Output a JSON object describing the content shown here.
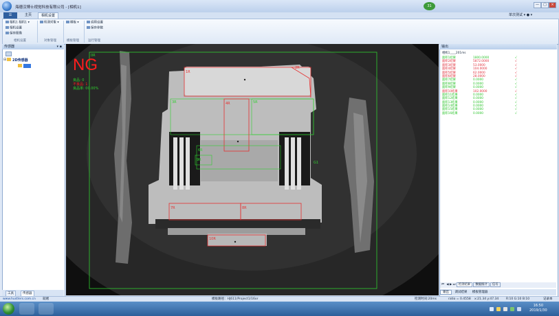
{
  "window": {
    "title": "海德汉博士视觉科技有限公司 - [相机1]",
    "status_badge": "31",
    "user_mode": "单次测试",
    "controls": [
      "—",
      "□",
      "×"
    ]
  },
  "ribbon_tabs": [
    "主页",
    "相机设置"
  ],
  "ribbon": {
    "camera_select": "相机1 相机1",
    "camera_settings": "相机设置",
    "save_image": "保存图像",
    "detect_object": "检测对象",
    "template": "模板",
    "run_settings": "调用设置",
    "save_params": "保存参数",
    "groups": [
      "相机设置",
      "对象管理",
      "模板管理",
      "运行管理"
    ]
  },
  "left_panel": {
    "title": "传感器",
    "tree_root": "2D传感器",
    "tabs": [
      "工具",
      "传感器"
    ]
  },
  "image_view": {
    "result": "NG",
    "stats": [
      "良品: 0",
      "不良品: 1",
      "良品率: 00.00%"
    ],
    "rois": [
      {
        "label": "0R"
      },
      {
        "label": "1R"
      },
      {
        "label": "2R"
      },
      {
        "label": "3R"
      },
      {
        "label": "4R"
      },
      {
        "label": "5R"
      },
      {
        "label": "6R"
      },
      {
        "label": "7R"
      },
      {
        "label": "8R"
      },
      {
        "label": "9R"
      },
      {
        "label": "10R"
      },
      {
        "label": "G1"
      }
    ]
  },
  "right_panel": {
    "title": "输出",
    "header": "相机1____201ms",
    "rows": [
      {
        "name": "面积1结果",
        "value": "1800.0000",
        "color": "#2ec52e"
      },
      {
        "name": "面积2结果",
        "value": "5872.0000",
        "color": "#e0303c"
      },
      {
        "name": "面积3结果",
        "value": "53.0000",
        "color": "#e0303c"
      },
      {
        "name": "面积4结果",
        "value": "104.0000",
        "color": "#e0303c"
      },
      {
        "name": "面积5结果",
        "value": "62.0000",
        "color": "#e0303c"
      },
      {
        "name": "面积6结果",
        "value": "28.0000",
        "color": "#e0303c"
      },
      {
        "name": "面积7结果",
        "value": "0.0000",
        "color": "#2ec52e"
      },
      {
        "name": "面积8结果",
        "value": "0.0000",
        "color": "#2ec52e"
      },
      {
        "name": "面积9结果",
        "value": "0.0000",
        "color": "#2ec52e"
      },
      {
        "name": "面积10结果",
        "value": "102.0000",
        "color": "#e0303c"
      },
      {
        "name": "面积11结果",
        "value": "0.0000",
        "color": "#2ec52e"
      },
      {
        "name": "面积12结果",
        "value": "0.0000",
        "color": "#2ec52e"
      },
      {
        "name": "面积13结果",
        "value": "0.0000",
        "color": "#2ec52e"
      },
      {
        "name": "面积14结果",
        "value": "0.0000",
        "color": "#2ec52e"
      },
      {
        "name": "面积15结果",
        "value": "0.0000",
        "color": "#2ec52e"
      },
      {
        "name": "面积16结果",
        "value": "0.0000",
        "color": "#2ec52e"
      }
    ],
    "row_flag": "√",
    "nav_tabs": [
      "检测结果",
      "数据统计",
      "信号"
    ],
    "bottom_tabs": [
      "输出",
      "调试结果",
      "模板管理器"
    ]
  },
  "status": {
    "website": "www.hustlers.com.cn",
    "state": "就绪",
    "path": "模板路径：HJ611/Project1/16or",
    "detect_time": "检测时间:20ms",
    "ratio": "ratio = 0.4558",
    "coords": "x:21.34 y:47.34",
    "rgb": "R:10 G:10 B:10",
    "extra": "记录本"
  },
  "taskbar": {
    "time": "16:50",
    "date": "2019/1/30"
  }
}
